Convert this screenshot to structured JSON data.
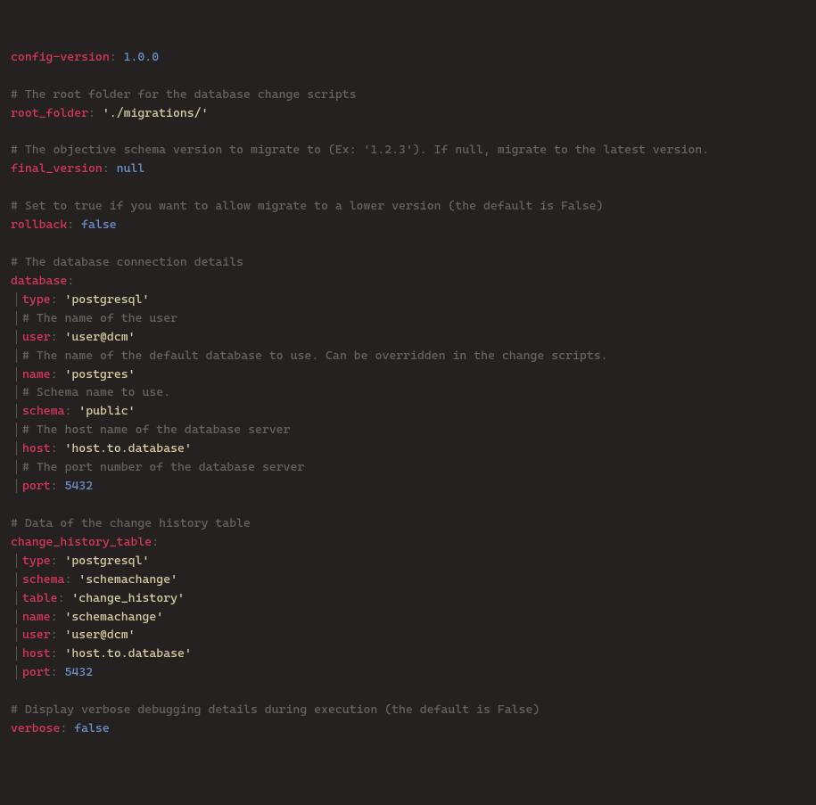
{
  "line1_key": "config-version",
  "line1_val": "1.0.0",
  "comment_root": "# The root folder for the database change scripts",
  "root_folder_key": "root_folder",
  "root_folder_val": "'./migrations/'",
  "comment_final": "# The objective schema version to migrate to (Ex: '1.2.3'). If null, migrate to the latest version.",
  "final_key": "final_version",
  "final_val": "null",
  "comment_rollback": "# Set to true if you want to allow migrate to a lower version (the default is False)",
  "rollback_key": "rollback",
  "rollback_val": "false",
  "comment_db": "# The database connection details",
  "database_key": "database",
  "db_type_key": "type",
  "db_type_val": "'postgresql'",
  "db_comment_user": "# The name of the user",
  "db_user_key": "user",
  "db_user_val": "'user@dcm'",
  "db_comment_name": "# The name of the default database to use. Can be overridden in the change scripts.",
  "db_name_key": "name",
  "db_name_val": "'postgres'",
  "db_comment_schema": "# Schema name to use.",
  "db_schema_key": "schema",
  "db_schema_val": "'public'",
  "db_comment_host": "# The host name of the database server",
  "db_host_key": "host",
  "db_host_val": "'host.to.database'",
  "db_comment_port": "# The port number of the database server",
  "db_port_key": "port",
  "db_port_val": "5432",
  "comment_cht": "# Data of the change history table",
  "cht_key": "change_history_table",
  "cht_type_key": "type",
  "cht_type_val": "'postgresql'",
  "cht_schema_key": "schema",
  "cht_schema_val": "'schemachange'",
  "cht_table_key": "table",
  "cht_table_val": "'change_history'",
  "cht_name_key": "name",
  "cht_name_val": "'schemachange'",
  "cht_user_key": "user",
  "cht_user_val": "'user@dcm'",
  "cht_host_key": "host",
  "cht_host_val": "'host.to.database'",
  "cht_port_key": "port",
  "cht_port_val": "5432",
  "comment_verbose": "# Display verbose debugging details during execution (the default is False)",
  "verbose_key": "verbose",
  "verbose_val": "false"
}
